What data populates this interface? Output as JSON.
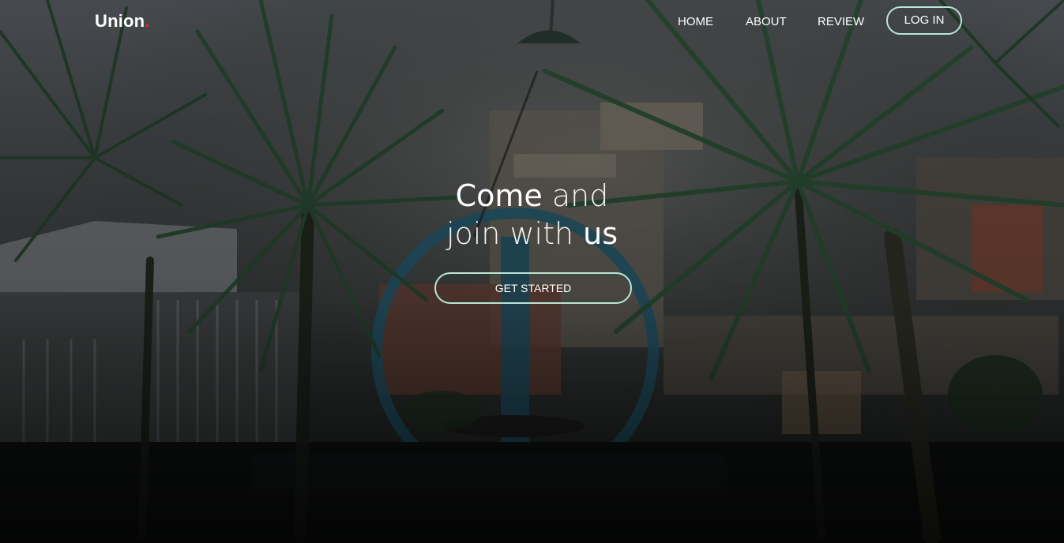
{
  "brand": {
    "name": "Union",
    "dot": "."
  },
  "nav": {
    "links": [
      "HOME",
      "ABOUT",
      "REVIEW"
    ],
    "login_label": "LOG IN"
  },
  "hero": {
    "line1_bold": "Come",
    "line1_light": " and",
    "line2_light": "join with ",
    "line2_bold": "us",
    "cta_label": "GET STARTED"
  },
  "colors": {
    "accent_outline": "#b9e6d6",
    "brand_dot": "#e0262c"
  },
  "icons": {
    "background": "garden-scene-image"
  }
}
